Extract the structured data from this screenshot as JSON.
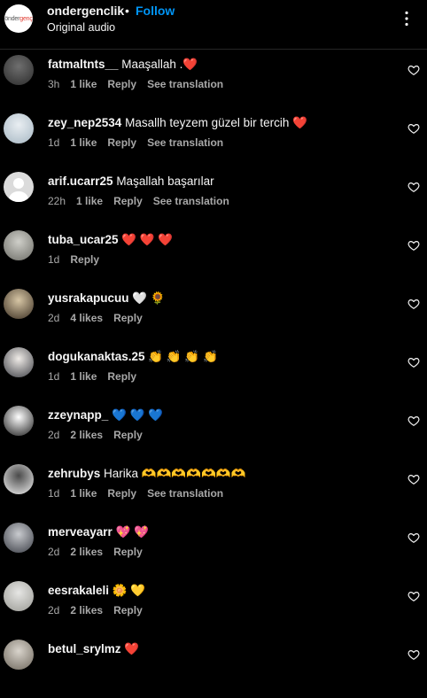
{
  "header": {
    "username": "ondergenclik",
    "separator": "•",
    "follow_label": "Follow",
    "subtitle": "Original audio",
    "logo_text": "önder",
    "logo_text_accent": "genç"
  },
  "comments": [
    {
      "username": "fatmaltnts__",
      "text": "Maaşallah .❤️",
      "time": "3h",
      "likes": "1 like",
      "reply": "Reply",
      "translate": "See translation",
      "avatar": "avatar-cat",
      "colors": [
        "#6f6f6f",
        "#2b2b2b"
      ]
    },
    {
      "username": "zey_nep2534",
      "text": "Masallh teyzem güzel bir tercih ❤️",
      "time": "1d",
      "likes": "1 like",
      "reply": "Reply",
      "translate": "See translation",
      "avatar": "avatar-photo",
      "colors": [
        "#e9eef2",
        "#a6b7c3"
      ]
    },
    {
      "username": "arif.ucarr25",
      "text": "Maşallah başarılar",
      "time": "22h",
      "likes": "1 like",
      "reply": "Reply",
      "translate": "See translation",
      "avatar": "avatar-default",
      "colors": [
        "#dbdbdb",
        "#ffffff"
      ]
    },
    {
      "username": "tuba_ucar25",
      "text": "❤️ ❤️ ❤️",
      "time": "1d",
      "likes": "",
      "reply": "Reply",
      "translate": "",
      "avatar": "avatar-photo",
      "colors": [
        "#cfcfc9",
        "#6c6c66"
      ]
    },
    {
      "username": "yusrakapucuu",
      "text": "🤍 🌻",
      "time": "2d",
      "likes": "4 likes",
      "reply": "Reply",
      "translate": "",
      "avatar": "avatar-photo",
      "colors": [
        "#d7c6a5",
        "#3b2f22"
      ]
    },
    {
      "username": "dogukanaktas.25",
      "text": "👏 👏 👏 👏",
      "time": "1d",
      "likes": "1 like",
      "reply": "Reply",
      "translate": "",
      "avatar": "avatar-photo",
      "colors": [
        "#f0ece8",
        "#3d3f45"
      ]
    },
    {
      "username": "zzeynapp_",
      "text": "💙 💙 💙",
      "time": "2d",
      "likes": "2 likes",
      "reply": "Reply",
      "translate": "",
      "avatar": "avatar-photo",
      "colors": [
        "#ffffff",
        "#1b1b1b"
      ]
    },
    {
      "username": "zehrubys",
      "text": "Harika 🫶🫶🫶🫶🫶🫶🫶",
      "time": "1d",
      "likes": "1 like",
      "reply": "Reply",
      "translate": "See translation",
      "avatar": "avatar-photo",
      "colors": [
        "#4a4a4a",
        "#f2f2f2"
      ]
    },
    {
      "username": "merveayarr",
      "text": "💖 💖",
      "time": "2d",
      "likes": "2 likes",
      "reply": "Reply",
      "translate": "",
      "avatar": "avatar-photo",
      "colors": [
        "#c9cbcf",
        "#3a3d45"
      ]
    },
    {
      "username": "eesrakaleli",
      "text": "🌼 💛",
      "time": "2d",
      "likes": "2 likes",
      "reply": "Reply",
      "translate": "",
      "avatar": "avatar-photo",
      "colors": [
        "#e6e6e4",
        "#9a9a94"
      ]
    },
    {
      "username": "betul_srylmz",
      "text": "❤️",
      "time": "",
      "likes": "",
      "reply": "",
      "translate": "",
      "avatar": "avatar-photo",
      "colors": [
        "#d9d4cc",
        "#6e675c"
      ]
    }
  ],
  "colors": {
    "follow": "#0095f6",
    "background": "#000000",
    "muted": "#a8a8a8"
  }
}
